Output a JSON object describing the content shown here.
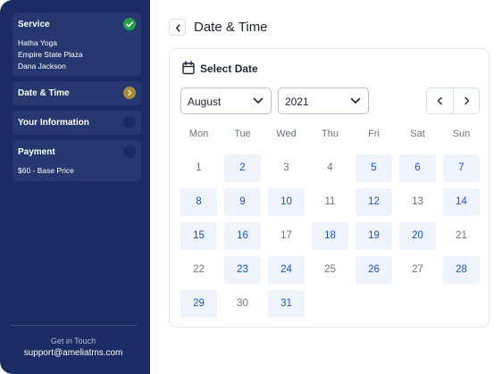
{
  "sidebar": {
    "steps": [
      {
        "title": "Service",
        "lines": [
          "Hatha Yoga",
          "Empire State Plaza",
          "Dana Jackson"
        ],
        "state": "done"
      },
      {
        "title": "Date & Time",
        "lines": [],
        "state": "current"
      },
      {
        "title": "Your Information",
        "lines": [],
        "state": "pending"
      },
      {
        "title": "Payment",
        "lines": [
          "$60 - Base Price"
        ],
        "state": "pending"
      }
    ],
    "footer": {
      "title": "Get in Touch",
      "email": "support@ameliatms.com"
    }
  },
  "header": {
    "title": "Date & Time"
  },
  "calendar": {
    "heading": "Select Date",
    "month": "August",
    "year": "2021",
    "weekdays": [
      "Mon",
      "Tue",
      "Wed",
      "Thu",
      "Fri",
      "Sat",
      "Sun"
    ],
    "days": [
      {
        "label": "1",
        "available": false
      },
      {
        "label": "2",
        "available": true
      },
      {
        "label": "3",
        "available": false
      },
      {
        "label": "4",
        "available": false
      },
      {
        "label": "5",
        "available": true
      },
      {
        "label": "6",
        "available": true
      },
      {
        "label": "7",
        "available": true
      },
      {
        "label": "8",
        "available": true
      },
      {
        "label": "9",
        "available": true
      },
      {
        "label": "10",
        "available": true
      },
      {
        "label": "11",
        "available": false
      },
      {
        "label": "12",
        "available": true
      },
      {
        "label": "13",
        "available": false
      },
      {
        "label": "14",
        "available": true
      },
      {
        "label": "15",
        "available": true
      },
      {
        "label": "16",
        "available": true
      },
      {
        "label": "17",
        "available": false
      },
      {
        "label": "18",
        "available": true
      },
      {
        "label": "19",
        "available": true
      },
      {
        "label": "20",
        "available": true
      },
      {
        "label": "21",
        "available": false
      },
      {
        "label": "22",
        "available": false
      },
      {
        "label": "23",
        "available": true
      },
      {
        "label": "24",
        "available": true
      },
      {
        "label": "25",
        "available": false
      },
      {
        "label": "26",
        "available": true
      },
      {
        "label": "27",
        "available": false
      },
      {
        "label": "28",
        "available": true
      },
      {
        "label": "29",
        "available": true
      },
      {
        "label": "30",
        "available": false
      },
      {
        "label": "31",
        "available": true
      }
    ]
  },
  "icons": {
    "done": "check-icon",
    "current": "chevron-right-icon",
    "back": "chevron-left-icon",
    "calendar": "calendar-icon",
    "dropdown": "chevron-down-icon",
    "prev": "chevron-left-icon",
    "next": "chevron-right-icon"
  },
  "colors": {
    "sidebar": "#1a2c63",
    "step_card": "#26386f",
    "done": "#24a148",
    "current": "#a38a3e",
    "available_bg": "#eef3fc",
    "available_text": "#1c53c9",
    "unavailable_text": "#6b7280"
  }
}
